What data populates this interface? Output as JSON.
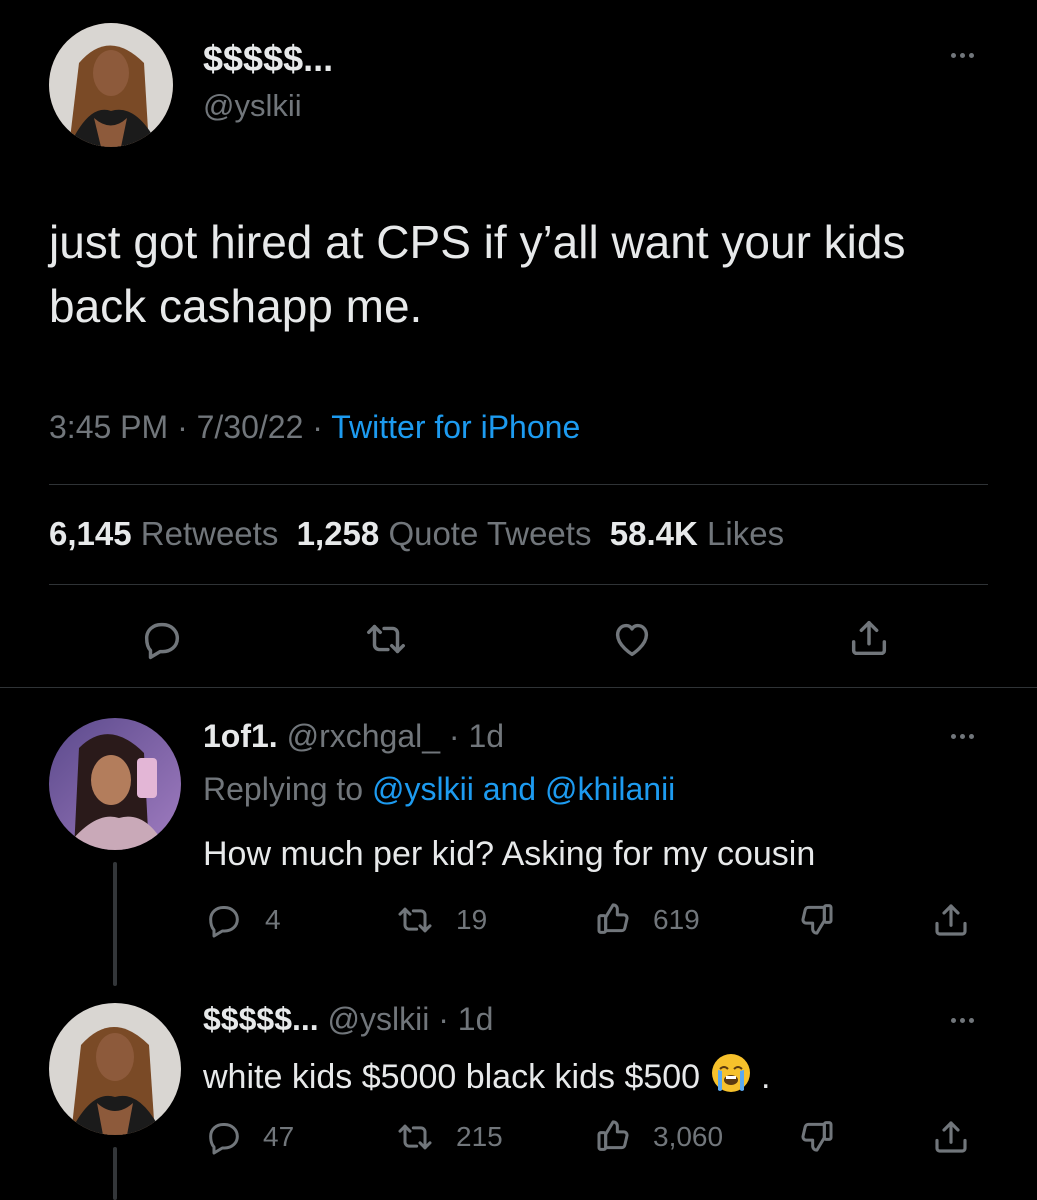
{
  "main_tweet": {
    "display_name": "$$$$$...",
    "handle": "@yslkii",
    "text": "just got hired at CPS if y’all want your kids back cashapp me.",
    "time": "3:45 PM",
    "date": "7/30/22",
    "source": "Twitter for iPhone",
    "stats": {
      "retweets_count": "6,145",
      "retweets_label": "Retweets",
      "quotes_count": "1,258",
      "quotes_label": "Quote Tweets",
      "likes_count": "58.4K",
      "likes_label": "Likes"
    }
  },
  "replies": [
    {
      "display_name": "1of1.",
      "handle": "@rxchgal_",
      "age": "1d",
      "replying_prefix": "Replying to",
      "replying_user1": "@yslkii",
      "replying_and": "and",
      "replying_user2": "@khilanii",
      "text": "How much per kid? Asking for my cousin",
      "reply_count": "4",
      "retweet_count": "19",
      "like_count": "619"
    },
    {
      "display_name": "$$$$$...",
      "handle": "@yslkii",
      "age": "1d",
      "text": "white kids $5000 black kids $500",
      "emoji": "😭",
      "text_end": ".",
      "reply_count": "47",
      "retweet_count": "215",
      "like_count": "3,060"
    }
  ],
  "colors": {
    "background": "#000000",
    "text": "#e7e9ea",
    "muted": "#71767b",
    "link": "#1d9bf0",
    "divider": "#2f3336"
  },
  "icons": [
    "reply-icon",
    "retweet-icon",
    "like-heart-icon",
    "share-icon",
    "thumbs-up-icon",
    "thumbs-down-icon",
    "more-icon"
  ]
}
